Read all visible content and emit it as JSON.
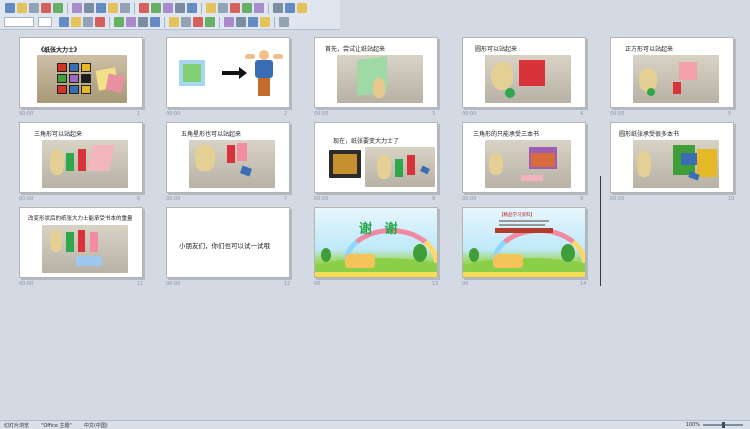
{
  "toolbar": {
    "row1_icons": [
      "new-icon",
      "open-icon",
      "save-icon",
      "print-icon",
      "preview-icon",
      "spell-icon",
      "cut-icon",
      "copy-icon",
      "paste-icon",
      "format-painter-icon",
      "undo-icon",
      "redo-icon",
      "hyperlink-icon",
      "table-icon",
      "chart-icon",
      "text-box-icon",
      "image-icon",
      "drawing-icon",
      "new-slide-icon",
      "grid-icon",
      "color-icon",
      "zoom-icon",
      "help-icon"
    ],
    "row2_icons": [
      "bold-icon",
      "italic-icon",
      "underline-icon",
      "shadow-icon",
      "align-left-icon",
      "align-center-icon",
      "align-right-icon",
      "numbering-icon",
      "bullets-icon",
      "increase-font-icon",
      "decrease-font-icon",
      "indent-icon",
      "outdent-icon",
      "font-color-icon",
      "design-icon",
      "new-slide-icon",
      "animation-icon"
    ],
    "colors": {
      "accent": "#3b6db3",
      "red": "#d1342b",
      "green": "#3f9e3a",
      "yellow": "#e5b828"
    }
  },
  "slides": [
    {
      "number": "1",
      "caption": "00:00",
      "title": "《纸张大力士》",
      "kind": "cover"
    },
    {
      "number": "2",
      "caption": "00:00",
      "title": "",
      "kind": "paper-arrow-strongman"
    },
    {
      "number": "3",
      "caption": "00:00",
      "title": "首先，尝试让纸站起来",
      "kind": "photo-green-paper"
    },
    {
      "number": "4",
      "caption": "00:00",
      "title": "圆形可以站起来",
      "kind": "photo-cylinder"
    },
    {
      "number": "5",
      "caption": "00:00",
      "title": "正方形可以站起来",
      "kind": "photo-square"
    },
    {
      "number": "6",
      "caption": "00:00",
      "title": "三角形可以站起来",
      "kind": "photo-triangle"
    },
    {
      "number": "7",
      "caption": "00:00",
      "title": "五角星形也可以站起来",
      "kind": "photo-star"
    },
    {
      "number": "8",
      "caption": "00:00",
      "title": "现在，纸张要变大力士了",
      "kind": "photo-two"
    },
    {
      "number": "9",
      "caption": "00:00",
      "title": "三角形的只能承受三本书",
      "kind": "photo-books"
    },
    {
      "number": "10",
      "caption": "00:00",
      "title": "圆形纸张承受很多本书",
      "kind": "photo-many-books"
    },
    {
      "number": "11",
      "caption": "00:00",
      "title": "改变形状后的纸张大力士能承受书本的重量",
      "kind": "photo-shapes"
    },
    {
      "number": "12",
      "caption": "00:00",
      "title": "小朋友们，你们也可以试一试哦",
      "kind": "text-only"
    },
    {
      "number": "13",
      "caption": "00",
      "title": "谢 谢",
      "kind": "thanks"
    },
    {
      "number": "14",
      "caption": "00",
      "title": "【精品学习资料】",
      "kind": "thanks-info"
    }
  ],
  "statusbar": {
    "slide_sorter": "幻灯片浏览",
    "theme": "\"Office 主题\"",
    "language": "中文(中国)",
    "zoom": "100%",
    "zoom_level": 0.5
  }
}
